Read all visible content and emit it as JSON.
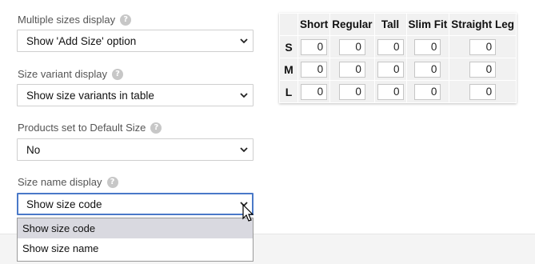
{
  "fields": [
    {
      "label": "Multiple sizes display",
      "value": "Show 'Add Size' option"
    },
    {
      "label": "Size variant display",
      "value": "Show size variants in table"
    },
    {
      "label": "Products set to Default Size",
      "value": "No"
    },
    {
      "label": "Size name display",
      "value": "Show size code"
    }
  ],
  "help_icon_glyph": "?",
  "dropdown_options": [
    "Show size code",
    "Show size name"
  ],
  "size_table": {
    "columns": [
      "Short",
      "Regular",
      "Tall",
      "Slim Fit",
      "Straight Leg"
    ],
    "rows": [
      {
        "label": "S",
        "values": [
          "0",
          "0",
          "0",
          "0",
          "0"
        ]
      },
      {
        "label": "M",
        "values": [
          "0",
          "0",
          "0",
          "0",
          "0"
        ]
      },
      {
        "label": "L",
        "values": [
          "0",
          "0",
          "0",
          "0",
          "0"
        ]
      }
    ]
  },
  "colors": {
    "focus_border": "#4a79c8",
    "selected_option_bg": "#d9d9e0"
  }
}
